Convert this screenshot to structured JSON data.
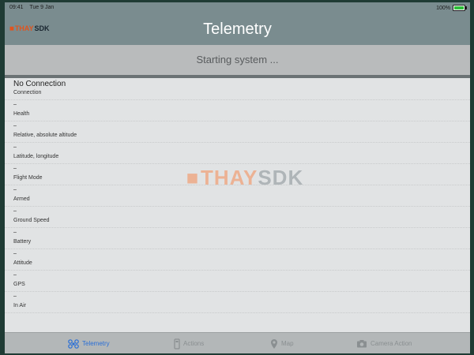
{
  "status_bar": {
    "time": "09:41",
    "date": "Tue 9 Jan",
    "battery": "100%",
    "battery_level": 1.0
  },
  "nav": {
    "logo_mark": "◼",
    "logo_thay": "THAY",
    "logo_sdk": "SDK",
    "title": "Telemetry"
  },
  "status_strip": {
    "text": "Starting system ..."
  },
  "rows": [
    {
      "value": "No Connection",
      "label": "Connection"
    },
    {
      "value": "–",
      "label": "Health"
    },
    {
      "value": "–",
      "label": "Relative, absolute altitude"
    },
    {
      "value": "–",
      "label": "Latitude, longitude"
    },
    {
      "value": "–",
      "label": "Flight Mode"
    },
    {
      "value": "–",
      "label": "Armed"
    },
    {
      "value": "–",
      "label": "Ground Speed"
    },
    {
      "value": "–",
      "label": "Battery"
    },
    {
      "value": "–",
      "label": "Attitude"
    },
    {
      "value": "–",
      "label": "GPS"
    },
    {
      "value": "–",
      "label": "In Air"
    }
  ],
  "watermark": {
    "mark": "◼",
    "part1": "THAY",
    "part2": "SDK"
  },
  "tabs": [
    {
      "label": "Telemetry",
      "icon": "drone-icon",
      "active": true
    },
    {
      "label": "Actions",
      "icon": "remote-icon",
      "active": false
    },
    {
      "label": "Map",
      "icon": "map-pin-icon",
      "active": false
    },
    {
      "label": "Camera Action",
      "icon": "camera-icon",
      "active": false
    }
  ],
  "colors": {
    "accent": "#2a6fd6",
    "brand": "#e0541f",
    "nav": "#7a8c8f"
  }
}
